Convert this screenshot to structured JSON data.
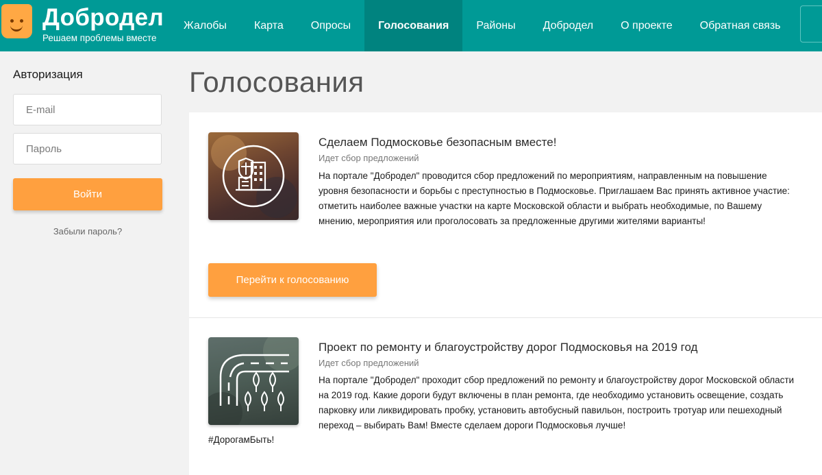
{
  "header": {
    "brand_name": "Добродел",
    "brand_tagline": "Решаем проблемы вместе",
    "nav": [
      {
        "label": "Жалобы",
        "active": false
      },
      {
        "label": "Карта",
        "active": false
      },
      {
        "label": "Опросы",
        "active": false
      },
      {
        "label": "Голосования",
        "active": true
      },
      {
        "label": "Районы",
        "active": false
      },
      {
        "label": "Добродел",
        "active": false
      },
      {
        "label": "О проекте",
        "active": false
      },
      {
        "label": "Обратная связь",
        "active": false
      }
    ]
  },
  "auth": {
    "title": "Авторизация",
    "email_placeholder": "E-mail",
    "password_placeholder": "Пароль",
    "login_label": "Войти",
    "forgot_label": "Забыли пароль?"
  },
  "page": {
    "title": "Голосования"
  },
  "cards": [
    {
      "title": "Сделаем Подмосковье безопасным вместе!",
      "status": "Идет сбор предложений",
      "description": "На портале \"Добродел\" проводится сбор предложений по мероприятиям, направленным на повышение уровня безопасности и борьбы с преступностью в Подмосковье. Приглашаем Вас принять активное участие: отметить наиболее важные участки на карте Московской области и выбрать необходимые, по Вашему мнению, мероприятия или проголосовать за предложенные другими жителями варианты!",
      "button_label": "Перейти к голосованию",
      "icon": "shield-building-icon"
    },
    {
      "title": "Проект по ремонту и благоустройству дорог Подмосковья на 2019 год",
      "status": "Идет сбор предложений",
      "description": "На портале \"Добродел\" проходит сбор предложений по ремонту и благоустройству дорог Московской области на 2019 год. Какие дороги будут включены в план ремонта, где необходимо установить освещение, создать парковку или ликвидировать пробку, установить автобусный павильон, построить тротуар или пешеходный переход – выбирать Вам! Вместе сделаем дороги Подмосковья лучше!",
      "hashtag": "#ДорогамБыть!",
      "icon": "road-trees-icon"
    }
  ],
  "colors": {
    "header_bg": "#009a96",
    "header_active": "#00837f",
    "accent_orange": "#ffa03f"
  }
}
